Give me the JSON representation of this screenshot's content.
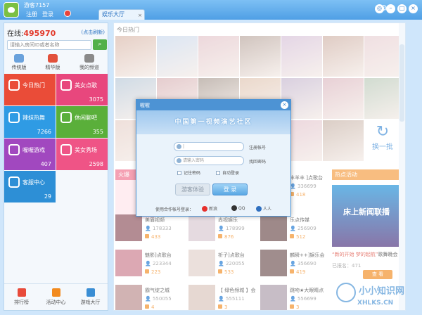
{
  "app": {
    "guest_name": "游客7157",
    "register": "注册",
    "login": "登录",
    "tab": "娱乐大厅",
    "tab_close": "×"
  },
  "sidebar": {
    "online_label": "在线:",
    "online_count": "495970",
    "refresh_link": "(点击刷新)",
    "search_placeholder": "请输入房间ID或者名称",
    "quick": [
      {
        "label": "传统版",
        "color": "#6aa2dc"
      },
      {
        "label": "精华版",
        "color": "#e2513b"
      },
      {
        "label": "我的频道",
        "color": "#8a8a8a"
      }
    ],
    "tiles": [
      {
        "label": "今日热门",
        "count": "",
        "color": "#ea4c38"
      },
      {
        "label": "美女点歌",
        "count": "3075",
        "color": "#e8477d"
      },
      {
        "label": "辣妹热舞",
        "count": "7266",
        "color": "#2f9be4"
      },
      {
        "label": "休闲聊吧",
        "count": "355",
        "color": "#5aaf3a"
      },
      {
        "label": "喔喔游戏",
        "count": "407",
        "color": "#a148bf"
      },
      {
        "label": "美女秀场",
        "count": "2598",
        "color": "#ef5486"
      },
      {
        "label": "客服中心",
        "count": "29",
        "color": "#2d8fd6"
      }
    ],
    "bottom_nav": [
      {
        "label": "排行榜",
        "color": "#e84b3a"
      },
      {
        "label": "活动中心",
        "color": "#f28a1e"
      },
      {
        "label": "游戏大厅",
        "color": "#3a8ed4"
      }
    ]
  },
  "main": {
    "section_title": "今日热门",
    "refresh_tile": "换一批",
    "hot_tag": "火爆",
    "list": [
      {
        "name": "丰羊丰 ]点歌台",
        "count": "336699",
        "score": "418"
      },
      {
        "name": "美眉视频",
        "count": "178333",
        "score": "433"
      },
      {
        "name": "尚视娱乐",
        "count": "178999",
        "score": "876"
      },
      {
        "name": "乐点传媒",
        "count": "256909",
        "score": "512"
      },
      {
        "name": "魅影]点歌台",
        "count": "223344",
        "score": "223"
      },
      {
        "name": "祈子]点歌台",
        "count": "220055",
        "score": "533"
      },
      {
        "name": "麟瞬++]娱乐会",
        "count": "356690",
        "score": "419"
      },
      {
        "name": "霸气绽之城",
        "count": "550055",
        "score": "4"
      },
      {
        "name": "【 绿色频城 】会",
        "count": "555111",
        "score": "3"
      },
      {
        "name": "跳吻★大眼睛点",
        "count": "556699",
        "score": "3"
      }
    ],
    "activity": {
      "title": "热点活动",
      "banner": "床上新闻联播",
      "desc_prefix": "“新的开始 梦的起航”",
      "desc_suffix": "歌舞晚会",
      "count": "已报名：471",
      "button": "查 看"
    }
  },
  "dialog": {
    "title": "喔喔",
    "banner": "中国第一视频演艺社区",
    "username_placeholder": "|",
    "username_link": "注册帐号",
    "password_placeholder": "请输入密码",
    "password_link": "找回密码",
    "remember": "记住密码",
    "auto_login": "自动登录",
    "guest_btn": "游客体验",
    "login_btn": "登 录",
    "other_label": "使用合作帐号登录：",
    "accounts": [
      {
        "label": "新浪",
        "color": "#e6302d"
      },
      {
        "label": "QQ",
        "color": "#333333"
      },
      {
        "label": "人人",
        "color": "#2f6fbf"
      }
    ]
  },
  "watermark": {
    "line1": "小小知识网",
    "line2": "XHLKS.CN"
  }
}
